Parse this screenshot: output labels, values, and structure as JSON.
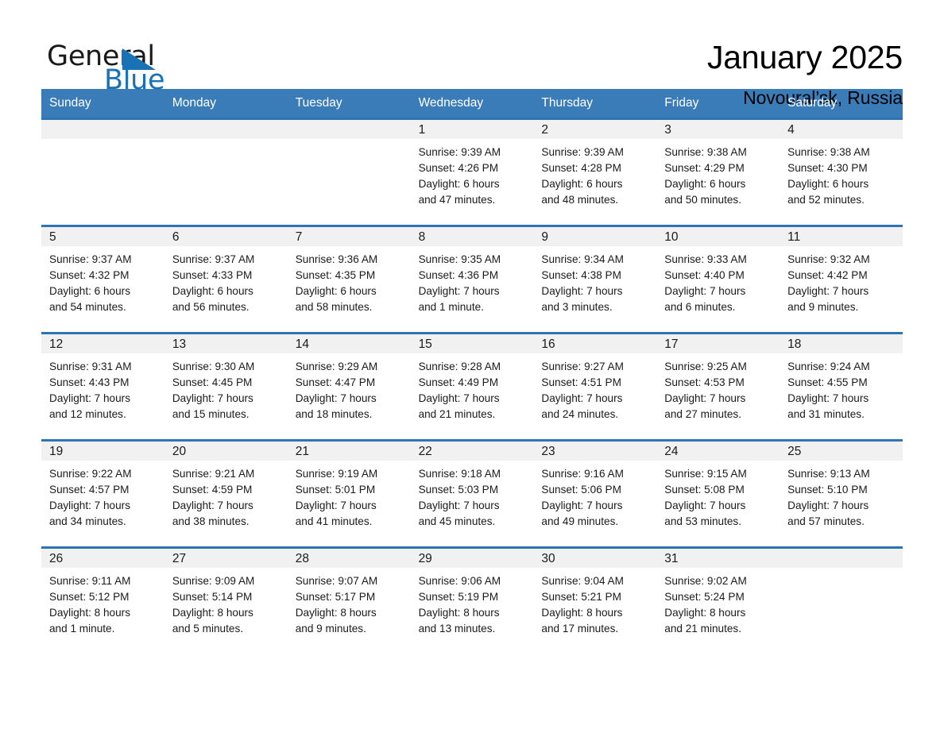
{
  "brand": {
    "word_one": "General",
    "word_two": "Blue",
    "accent_color": "#1972b6",
    "triangle_icon": "brand-triangle-icon"
  },
  "header": {
    "title": "January 2025",
    "location": "Novoural’sk, Russia"
  },
  "calendar": {
    "header_bg": "#3a7cb8",
    "row_divider_color": "#2e74b5",
    "daynum_band_bg": "#f1f1f1",
    "weekdays": [
      "Sunday",
      "Monday",
      "Tuesday",
      "Wednesday",
      "Thursday",
      "Friday",
      "Saturday"
    ],
    "weeks": [
      [
        {
          "day": "",
          "info": ""
        },
        {
          "day": "",
          "info": ""
        },
        {
          "day": "",
          "info": ""
        },
        {
          "day": "1",
          "info": "Sunrise: 9:39 AM\nSunset: 4:26 PM\nDaylight: 6 hours\nand 47 minutes."
        },
        {
          "day": "2",
          "info": "Sunrise: 9:39 AM\nSunset: 4:28 PM\nDaylight: 6 hours\nand 48 minutes."
        },
        {
          "day": "3",
          "info": "Sunrise: 9:38 AM\nSunset: 4:29 PM\nDaylight: 6 hours\nand 50 minutes."
        },
        {
          "day": "4",
          "info": "Sunrise: 9:38 AM\nSunset: 4:30 PM\nDaylight: 6 hours\nand 52 minutes."
        }
      ],
      [
        {
          "day": "5",
          "info": "Sunrise: 9:37 AM\nSunset: 4:32 PM\nDaylight: 6 hours\nand 54 minutes."
        },
        {
          "day": "6",
          "info": "Sunrise: 9:37 AM\nSunset: 4:33 PM\nDaylight: 6 hours\nand 56 minutes."
        },
        {
          "day": "7",
          "info": "Sunrise: 9:36 AM\nSunset: 4:35 PM\nDaylight: 6 hours\nand 58 minutes."
        },
        {
          "day": "8",
          "info": "Sunrise: 9:35 AM\nSunset: 4:36 PM\nDaylight: 7 hours\nand 1 minute."
        },
        {
          "day": "9",
          "info": "Sunrise: 9:34 AM\nSunset: 4:38 PM\nDaylight: 7 hours\nand 3 minutes."
        },
        {
          "day": "10",
          "info": "Sunrise: 9:33 AM\nSunset: 4:40 PM\nDaylight: 7 hours\nand 6 minutes."
        },
        {
          "day": "11",
          "info": "Sunrise: 9:32 AM\nSunset: 4:42 PM\nDaylight: 7 hours\nand 9 minutes."
        }
      ],
      [
        {
          "day": "12",
          "info": "Sunrise: 9:31 AM\nSunset: 4:43 PM\nDaylight: 7 hours\nand 12 minutes."
        },
        {
          "day": "13",
          "info": "Sunrise: 9:30 AM\nSunset: 4:45 PM\nDaylight: 7 hours\nand 15 minutes."
        },
        {
          "day": "14",
          "info": "Sunrise: 9:29 AM\nSunset: 4:47 PM\nDaylight: 7 hours\nand 18 minutes."
        },
        {
          "day": "15",
          "info": "Sunrise: 9:28 AM\nSunset: 4:49 PM\nDaylight: 7 hours\nand 21 minutes."
        },
        {
          "day": "16",
          "info": "Sunrise: 9:27 AM\nSunset: 4:51 PM\nDaylight: 7 hours\nand 24 minutes."
        },
        {
          "day": "17",
          "info": "Sunrise: 9:25 AM\nSunset: 4:53 PM\nDaylight: 7 hours\nand 27 minutes."
        },
        {
          "day": "18",
          "info": "Sunrise: 9:24 AM\nSunset: 4:55 PM\nDaylight: 7 hours\nand 31 minutes."
        }
      ],
      [
        {
          "day": "19",
          "info": "Sunrise: 9:22 AM\nSunset: 4:57 PM\nDaylight: 7 hours\nand 34 minutes."
        },
        {
          "day": "20",
          "info": "Sunrise: 9:21 AM\nSunset: 4:59 PM\nDaylight: 7 hours\nand 38 minutes."
        },
        {
          "day": "21",
          "info": "Sunrise: 9:19 AM\nSunset: 5:01 PM\nDaylight: 7 hours\nand 41 minutes."
        },
        {
          "day": "22",
          "info": "Sunrise: 9:18 AM\nSunset: 5:03 PM\nDaylight: 7 hours\nand 45 minutes."
        },
        {
          "day": "23",
          "info": "Sunrise: 9:16 AM\nSunset: 5:06 PM\nDaylight: 7 hours\nand 49 minutes."
        },
        {
          "day": "24",
          "info": "Sunrise: 9:15 AM\nSunset: 5:08 PM\nDaylight: 7 hours\nand 53 minutes."
        },
        {
          "day": "25",
          "info": "Sunrise: 9:13 AM\nSunset: 5:10 PM\nDaylight: 7 hours\nand 57 minutes."
        }
      ],
      [
        {
          "day": "26",
          "info": "Sunrise: 9:11 AM\nSunset: 5:12 PM\nDaylight: 8 hours\nand 1 minute."
        },
        {
          "day": "27",
          "info": "Sunrise: 9:09 AM\nSunset: 5:14 PM\nDaylight: 8 hours\nand 5 minutes."
        },
        {
          "day": "28",
          "info": "Sunrise: 9:07 AM\nSunset: 5:17 PM\nDaylight: 8 hours\nand 9 minutes."
        },
        {
          "day": "29",
          "info": "Sunrise: 9:06 AM\nSunset: 5:19 PM\nDaylight: 8 hours\nand 13 minutes."
        },
        {
          "day": "30",
          "info": "Sunrise: 9:04 AM\nSunset: 5:21 PM\nDaylight: 8 hours\nand 17 minutes."
        },
        {
          "day": "31",
          "info": "Sunrise: 9:02 AM\nSunset: 5:24 PM\nDaylight: 8 hours\nand 21 minutes."
        },
        {
          "day": "",
          "info": ""
        }
      ]
    ]
  }
}
